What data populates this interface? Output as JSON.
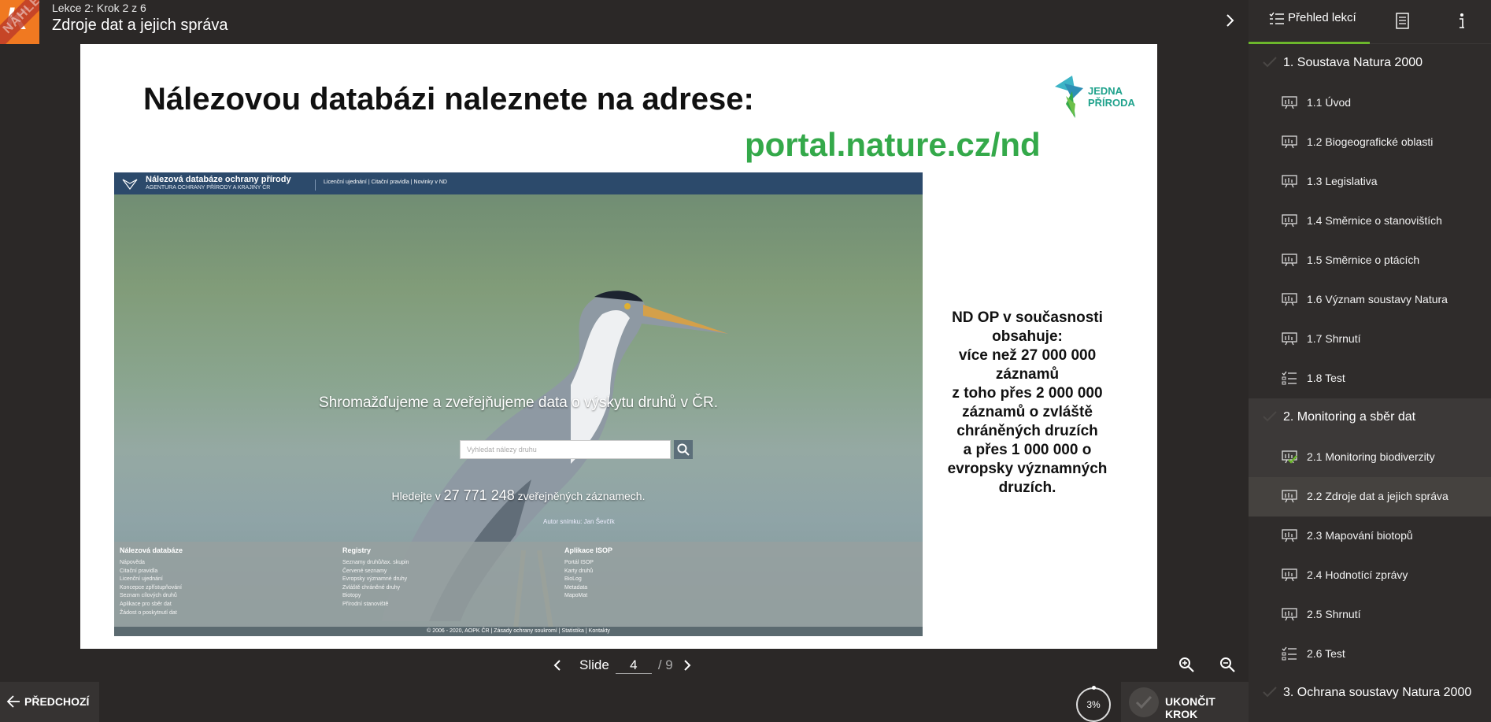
{
  "header": {
    "breadcrumb": "Lekce 2: Krok 2 z 6",
    "title": "Zdroje dat a jejich správa",
    "logo_letter": "K",
    "watermark": "NÁHLED"
  },
  "sidebar": {
    "tab_lessons": "Přehled lekcí",
    "sections": [
      {
        "label": "1. Soustava Natura 2000",
        "items": [
          {
            "label": "1.1 Úvod",
            "icon": "slides-icon"
          },
          {
            "label": "1.2 Biogeografické oblasti",
            "icon": "slides-icon"
          },
          {
            "label": "1.3 Legislativa",
            "icon": "slides-icon"
          },
          {
            "label": "1.4 Směrnice o stanovištích",
            "icon": "slides-icon"
          },
          {
            "label": "1.5 Směrnice o ptácích",
            "icon": "slides-icon"
          },
          {
            "label": "1.6 Význam soustavy Natura",
            "icon": "slides-icon"
          },
          {
            "label": "1.7 Shrnutí",
            "icon": "slides-icon"
          },
          {
            "label": "1.8 Test",
            "icon": "test-icon"
          }
        ]
      },
      {
        "label": "2. Monitoring a sběr dat",
        "items": [
          {
            "label": "2.1 Monitoring biodiverzity",
            "icon": "slides-icon",
            "done": true
          },
          {
            "label": "2.2 Zdroje dat a jejich správa",
            "icon": "slides-icon",
            "current": true
          },
          {
            "label": "2.3 Mapování biotopů",
            "icon": "slides-icon"
          },
          {
            "label": "2.4 Hodnotící zprávy",
            "icon": "slides-icon"
          },
          {
            "label": "2.5 Shrnutí",
            "icon": "slides-icon"
          },
          {
            "label": "2.6 Test",
            "icon": "test-icon"
          }
        ]
      },
      {
        "label": "3. Ochrana soustavy Natura 2000",
        "items": []
      }
    ]
  },
  "slide": {
    "heading": "Nálezovou databázi naleznete na adrese:",
    "url": "portal.nature.cz/nd",
    "brand_line1": "JEDNA",
    "brand_line2": "PŘÍRODA",
    "stats_lines": [
      "ND OP v  současnosti",
      "obsahuje:",
      "více než 27 000 000",
      "záznamů",
      "z toho přes 2 000 000",
      "záznamů  o zvláště",
      "chráněných druzích",
      "a přes 1 000 000 o",
      "evropsky významných",
      "druzích."
    ],
    "screenshot": {
      "site_title": "Nálezová databáze ochrany přírody",
      "site_subtitle": "AGENTURA OCHRANY PŘÍRODY A KRAJINY ČR",
      "top_links": "Licenční ujednání | Citační pravidla | Novinky v ND",
      "claim": "Shromažďujeme a zveřejňujeme data o výskytu druhů v ČR.",
      "search_placeholder": "Vyhledat nálezy druhu",
      "found_prefix": "Hledejte v",
      "found_count": "27 771 248",
      "found_suffix": "zveřejněných záznamech.",
      "credit": "Autor snímku: Jan Ševčík",
      "footer_cols": [
        {
          "title": "Nálezová databáze",
          "links": [
            "Nápověda",
            "Citační pravidla",
            "Licenční ujednání",
            "Koncepce zpřístupňování",
            "Seznam cílových druhů",
            "Aplikace pro sběr dat",
            "Žádost o poskytnutí dat"
          ]
        },
        {
          "title": "Registry",
          "links": [
            "Seznamy druhů/tax. skupin",
            "Červené seznamy",
            "Evropsky významné druhy",
            "Zvláště chráněné druhy",
            "Biotopy",
            "Přírodní stanoviště"
          ]
        },
        {
          "title": "Aplikace ISOP",
          "links": [
            "Portál ISOP",
            "Karty druhů",
            "BioLog",
            "Metadata",
            "MapoMat"
          ]
        }
      ],
      "copyright": "© 2006 - 2020, AOPK ČR  |  Zásady ochrany soukromí  |  Statistika  |  Kontakty"
    }
  },
  "controls": {
    "slide_label": "Slide",
    "slide_current": "4",
    "slide_total": "/ 9",
    "prev_label": "PŘEDCHOZÍ",
    "progress": "3%",
    "finish_label": "UKONČIT KROK"
  },
  "colors": {
    "accent_orange": "#f07921",
    "accent_green": "#6cb72c",
    "url_green": "#34a94a"
  }
}
